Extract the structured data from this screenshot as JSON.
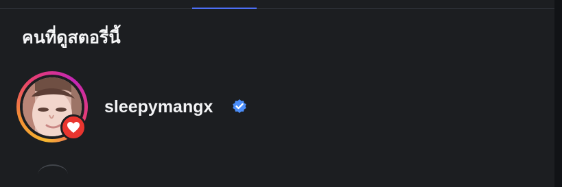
{
  "section": {
    "title": "คนที่ดูสตอรี่นี้"
  },
  "viewers": [
    {
      "username": "sleepymangx",
      "verified": true,
      "reaction": "heart-icon",
      "colors": {
        "ring_start": "#f7b731",
        "ring_middle": "#e83f6f",
        "ring_end": "#c426b6",
        "reaction_background": "#e9352f",
        "verified_badge": "#4b8df8"
      }
    }
  ],
  "tabs": {
    "active_indicator_color": "#4c6ef5"
  },
  "theme": {
    "background": "#1c1e21",
    "text": "#f2f3f5"
  }
}
